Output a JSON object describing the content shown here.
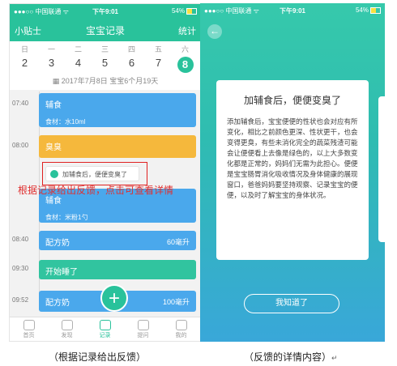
{
  "left_screen": {
    "status": {
      "signal": "●●●○○ 中国联通 ᯤ",
      "time": "下午9:01",
      "battery": "54%"
    },
    "nav": {
      "left": "小贴士",
      "title": "宝宝记录",
      "right": "统计"
    },
    "week": {
      "day_names": [
        "日",
        "一",
        "二",
        "三",
        "四",
        "五",
        "六"
      ],
      "dates": [
        "2",
        "3",
        "4",
        "5",
        "6",
        "7",
        "8"
      ],
      "date_line": "2017年7月8日 宝宝6个月19天"
    },
    "timeline": [
      {
        "time": "07:40",
        "title": "辅食",
        "detail": "食材：水10ml",
        "amount": "",
        "color": "#4aa8ec"
      },
      {
        "time": "08:00",
        "title": "臭臭",
        "detail": "",
        "amount": "",
        "color": "#f5b83c"
      },
      {
        "time": "",
        "title": "辅食",
        "detail": "食材：米粉1勺",
        "amount": "",
        "color": "#4aa8ec"
      },
      {
        "time": "08:40",
        "title": "配方奶",
        "detail": "",
        "amount": "60毫升",
        "color": "#4aa8ec"
      },
      {
        "time": "09:30",
        "title": "开始睡了",
        "detail": "",
        "amount": "",
        "color": "#31c49f"
      },
      {
        "time": "09:52",
        "title": "配方奶",
        "detail": "",
        "amount": "100毫升",
        "color": "#4aa8ec"
      }
    ],
    "feedback_chip": "加辅食后，便便变臭了",
    "annotation": "根据记录给出反馈，点击可查看详情",
    "fab": "+",
    "tabs": [
      "首页",
      "发现",
      "记录",
      "提问",
      "我的"
    ]
  },
  "right_screen": {
    "status": {
      "signal": "●●●○○ 中国联通 ᯤ",
      "time": "下午9:01",
      "battery": "54%"
    },
    "back": "←",
    "popup_title": "加辅食后，便便变臭了",
    "popup_body": "添加辅食后，宝宝便便的性状也会对应有所变化，相比之前颜色更深、性状更干，也会变得更臭，有些未消化完全的蔬菜残渣可能会让便便看上去像是绿色的，以上大多数变化都是正常的，妈妈们无需为此担心。便便是宝宝肠胃消化吸收情况及身体健康的展现窗口，爸爸妈妈要坚持观察、记录宝宝的便便，以及时了解宝宝的身体状况。",
    "ok_button": "我知道了"
  },
  "captions": {
    "left": "（根据记录给出反馈）",
    "right": "（反馈的详情内容）",
    "return_mark": "↵"
  }
}
